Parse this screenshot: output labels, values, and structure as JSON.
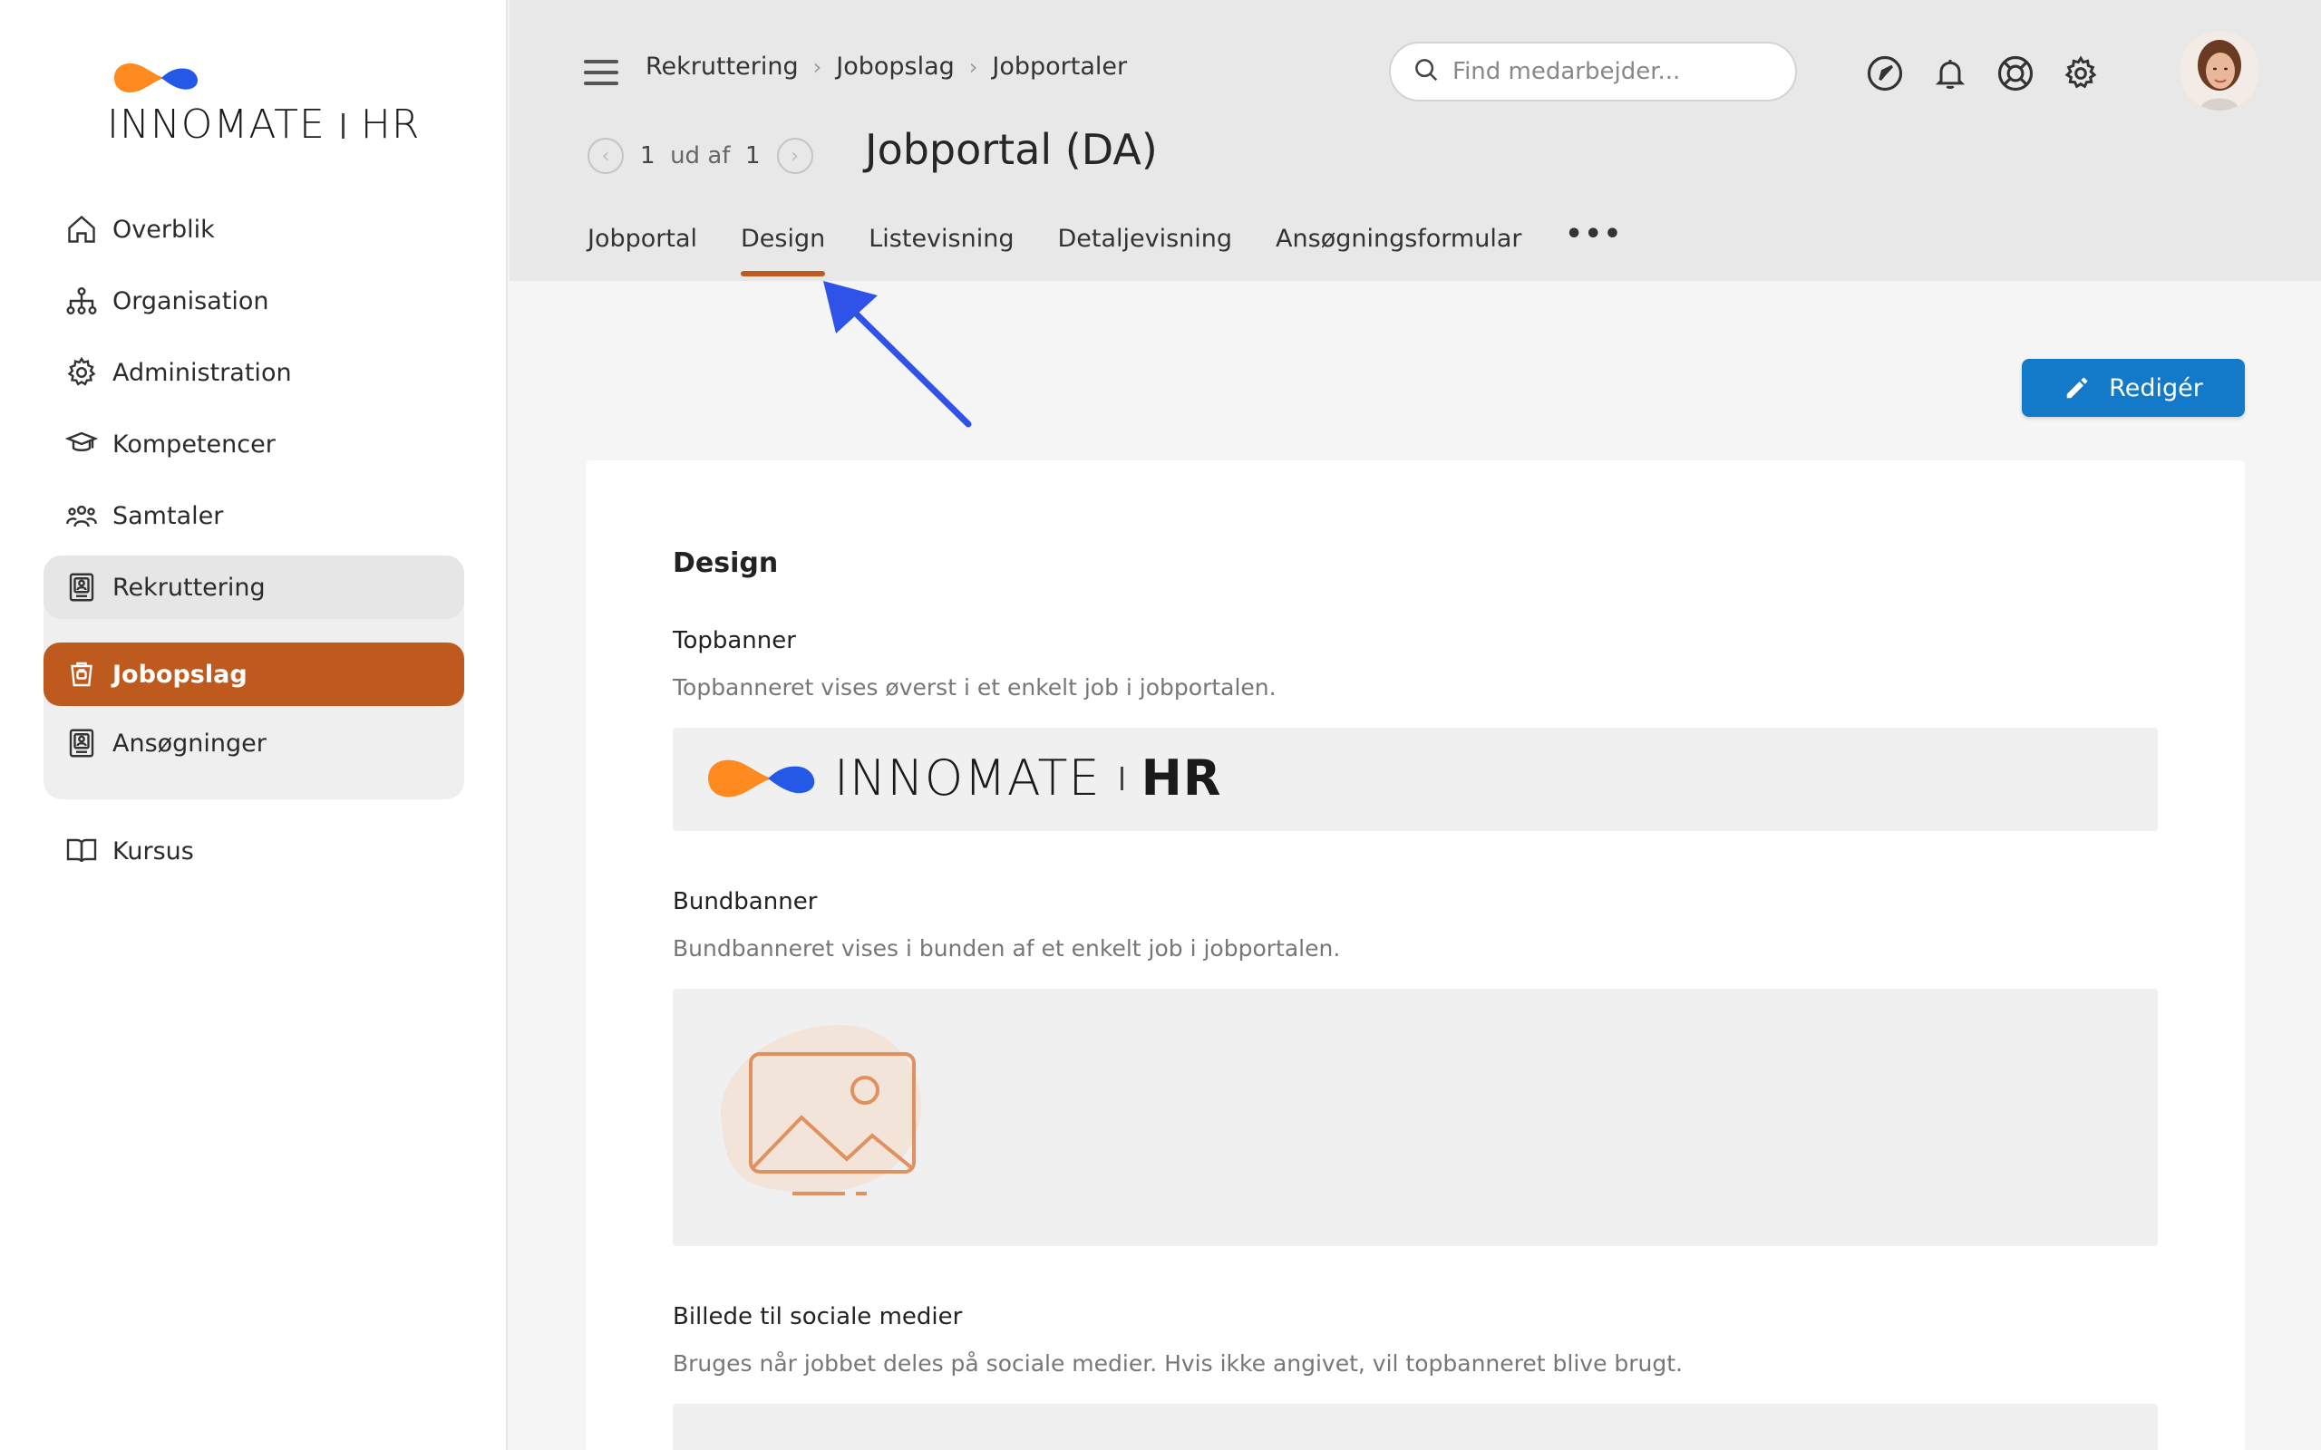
{
  "brand": {
    "name_light": "INNOMATE",
    "name_bold": "HR",
    "orange": "#ff8a1f",
    "blue": "#2459e8"
  },
  "sidebar": {
    "items": [
      {
        "label": "Overblik",
        "icon": "home-icon"
      },
      {
        "label": "Organisation",
        "icon": "org-chart-icon"
      },
      {
        "label": "Administration",
        "icon": "gear-icon"
      },
      {
        "label": "Kompetencer",
        "icon": "graduation-cap-icon"
      },
      {
        "label": "Samtaler",
        "icon": "people-icon"
      }
    ],
    "group": {
      "head": {
        "label": "Rekruttering",
        "icon": "id-badge-icon"
      },
      "children": [
        {
          "label": "Jobopslag",
          "icon": "job-post-icon",
          "active": true
        },
        {
          "label": "Ansøgninger",
          "icon": "id-badge-icon"
        }
      ]
    },
    "after": [
      {
        "label": "Kursus",
        "icon": "book-icon"
      }
    ],
    "accent": "#bf5a1f"
  },
  "header": {
    "breadcrumb": [
      "Rekruttering",
      "Jobopslag",
      "Jobportaler"
    ],
    "pager": {
      "current": "1",
      "of_label": "ud af",
      "total": "1"
    },
    "title": "Jobportal (DA)",
    "tabs": [
      "Jobportal",
      "Design",
      "Listevisning",
      "Detaljevisning",
      "Ansøgningsformular"
    ],
    "active_tab": "Design",
    "more": "•••",
    "search_placeholder": "Find medarbejder...",
    "icons": [
      "navigation-icon",
      "bell-icon",
      "lifebuoy-icon",
      "gear-icon"
    ]
  },
  "toolbar": {
    "edit_label": "Redigér",
    "edit_color": "#1379c9"
  },
  "content": {
    "heading": "Design",
    "sections": [
      {
        "label": "Topbanner",
        "desc": "Topbanneret vises øverst i et enkelt job i jobportalen."
      },
      {
        "label": "Bundbanner",
        "desc": "Bundbanneret vises i bunden af et enkelt job i jobportalen."
      },
      {
        "label": "Billede til sociale medier",
        "desc": "Bruges når jobbet deles på sociale medier. Hvis ikke angivet, vil topbanneret blive brugt."
      }
    ]
  }
}
